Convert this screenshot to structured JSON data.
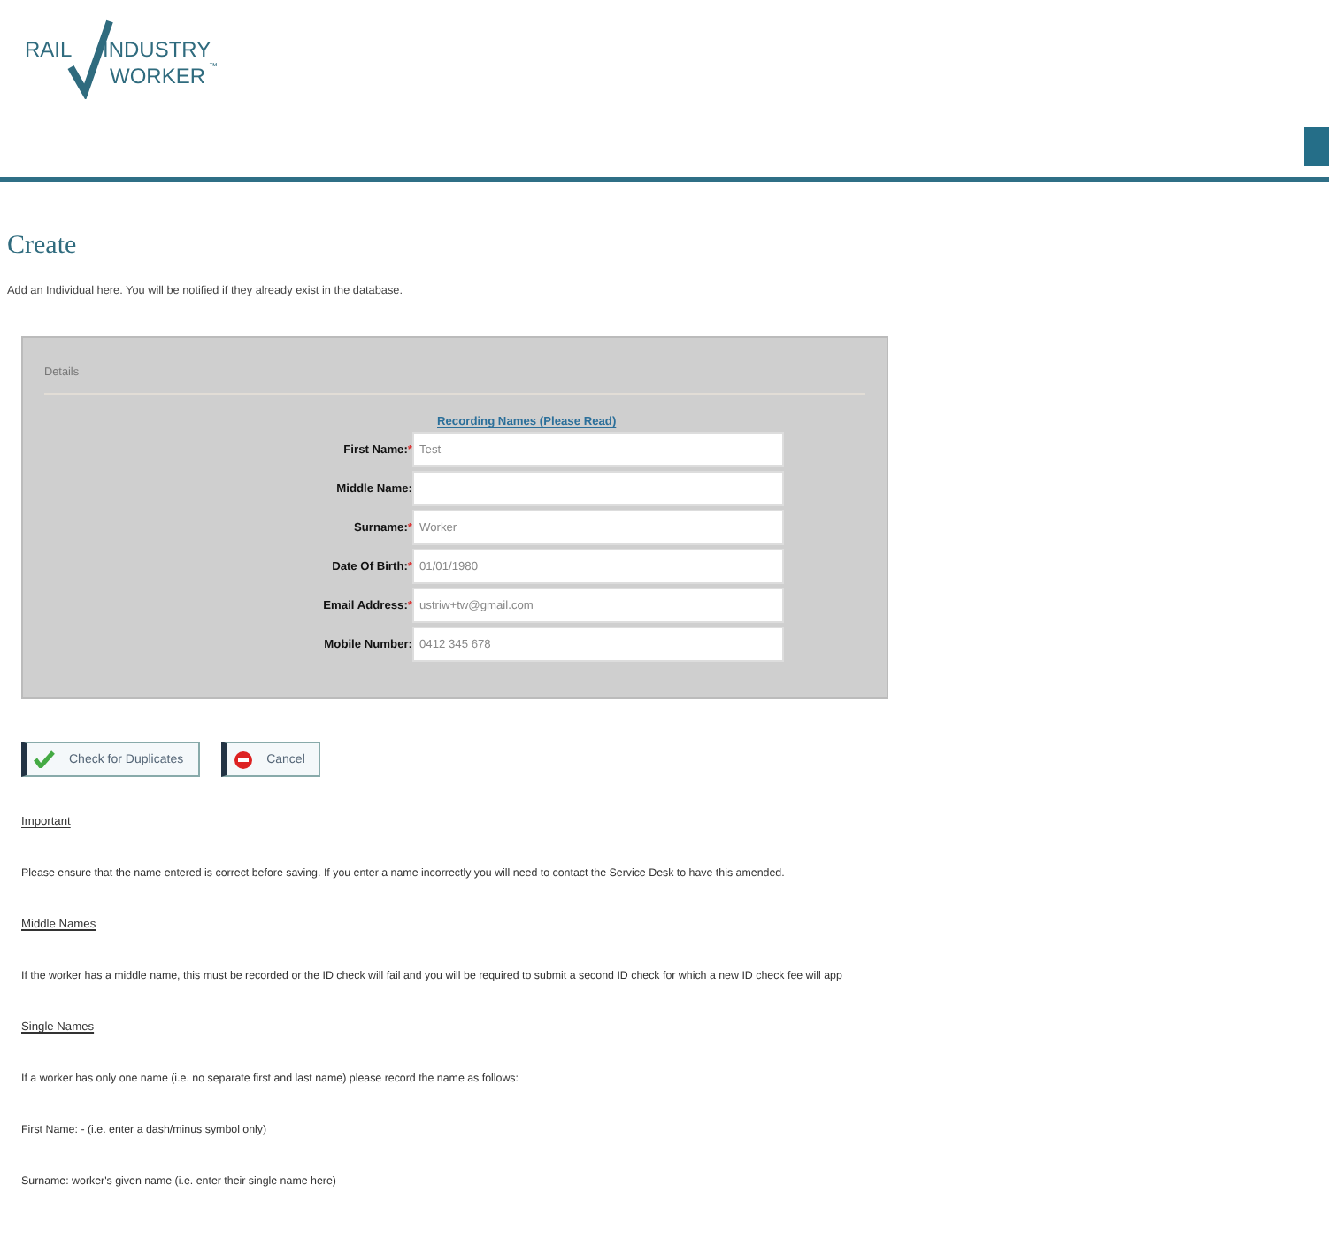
{
  "logo": {
    "top": "RAIL",
    "right": "INDUSTRY",
    "bottom": "WORKER",
    "mark": "™"
  },
  "page": {
    "title": "Create",
    "intro": "Add an Individual here. You will be notified if they already exist in the database."
  },
  "details": {
    "legend": "Details",
    "link": "Recording Names (Please Read)",
    "fields": [
      {
        "label": "First Name:",
        "required_mark": "*",
        "value": "Test"
      },
      {
        "label": "Middle Name:"
      },
      {
        "label": "Surname:",
        "required_mark": "*",
        "value": "Worker"
      },
      {
        "label": "Date Of Birth:",
        "required_mark": "*",
        "value": "01/01/1980"
      },
      {
        "label": "Email Address:",
        "required_mark": "*",
        "value": "ustriw+tw@gmail.com"
      },
      {
        "label": "Mobile Number:",
        "value": "0412 345 678"
      }
    ]
  },
  "buttons": [
    {
      "kind": "check",
      "label": "Check for Duplicates"
    },
    {
      "kind": "cancel",
      "label": "Cancel"
    }
  ],
  "notes": [
    {
      "kind": "heading",
      "text": "Important"
    },
    {
      "kind": "text",
      "text": "Please ensure that the name entered is correct before saving. If you enter a name incorrectly you will need to contact the Service Desk to have this amended."
    },
    {
      "kind": "heading",
      "text": "Middle Names"
    },
    {
      "kind": "text",
      "text": "If the worker has a middle name, this must be recorded or the ID check will fail and you will be required to submit a second ID check for which a new ID check fee will app"
    },
    {
      "kind": "heading",
      "text": "Single Names"
    },
    {
      "kind": "text",
      "text": "If a worker has only one name (i.e. no separate first and last name) please record the name as follows:"
    },
    {
      "kind": "text",
      "text": "First Name: - (i.e. enter a dash/minus symbol only)"
    },
    {
      "kind": "text",
      "text": "Surname: worker's given name (i.e. enter their single name here)"
    }
  ]
}
